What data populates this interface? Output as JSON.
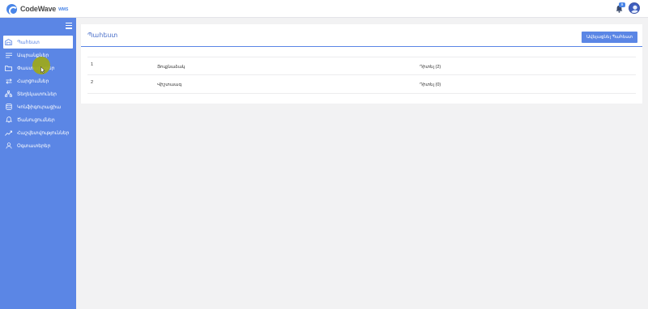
{
  "app": {
    "logo_text": "CodeWave",
    "logo_sub": "WMS"
  },
  "header": {
    "notification_count": "9"
  },
  "sidebar": {
    "items": [
      {
        "label": "Պահեստ",
        "icon": "warehouse-icon",
        "active": true
      },
      {
        "label": "Ապրանքներ",
        "icon": "list-icon",
        "active": false
      },
      {
        "label": "Փաստաթղթեր",
        "icon": "folder-icon",
        "active": false
      },
      {
        "label": "Հարցումներ",
        "icon": "swap-icon",
        "active": false
      },
      {
        "label": "Տեղեկատուներ",
        "icon": "hierarchy-icon",
        "active": false
      },
      {
        "label": "Կոնֆիգուրացիա",
        "icon": "database-icon",
        "active": false
      },
      {
        "label": "Ծանուցումներ",
        "icon": "bell-icon",
        "active": false
      },
      {
        "label": "Հաշվետվություններ",
        "icon": "chart-icon",
        "active": false
      },
      {
        "label": "Օգտատերեր",
        "icon": "user-icon",
        "active": false
      }
    ]
  },
  "page": {
    "title": "Պահեստ",
    "add_button_label": "Ավելացնել Պահեստ"
  },
  "table": {
    "rows": [
      {
        "num": "1",
        "name": "Յուքնաձակ",
        "link": "Դիտել (2)"
      },
      {
        "num": "2",
        "name": "Վիշտաագ",
        "link": "Դիտել (0)"
      }
    ]
  },
  "colors": {
    "accent": "#5b86e5",
    "topbar": "#ffffff",
    "background": "#f2f2f3"
  }
}
